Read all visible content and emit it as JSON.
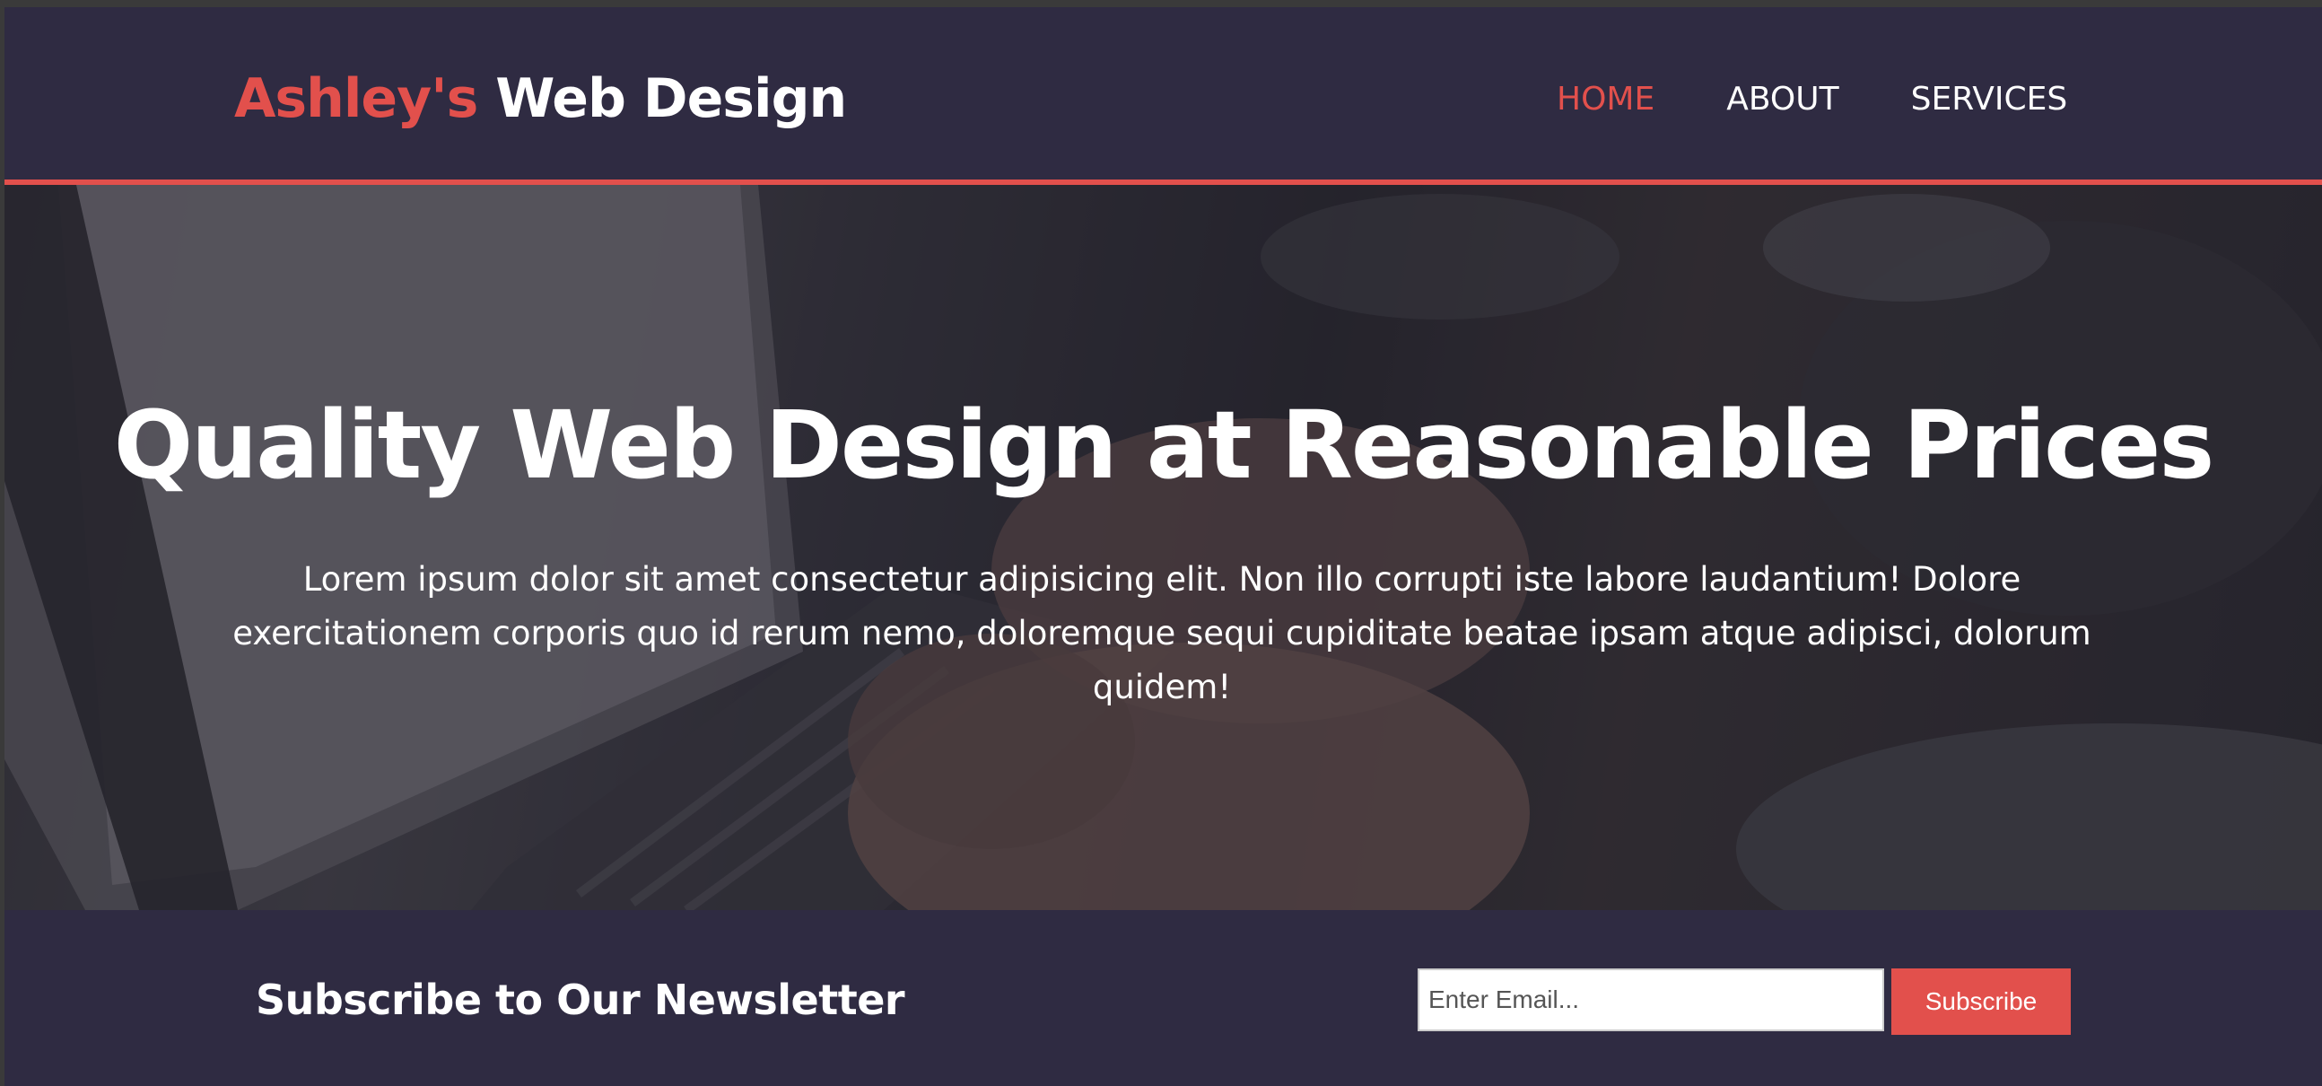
{
  "header": {
    "logo_accent": "Ashley's",
    "logo_rest": " Web Design",
    "nav": [
      {
        "label": "HOME",
        "active": true
      },
      {
        "label": "ABOUT",
        "active": false
      },
      {
        "label": "SERVICES",
        "active": false
      }
    ]
  },
  "hero": {
    "title": "Quality Web Design at Reasonable Prices",
    "text": "Lorem ipsum dolor sit amet consectetur adipisicing elit. Non illo corrupti iste labore laudantium! Dolore exercitationem corporis quo id rerum nemo, doloremque sequi cupiditate beatae ipsam atque adipisci, dolorum quidem!"
  },
  "newsletter": {
    "title": "Subscribe to Our Newsletter",
    "email_placeholder": "Enter Email...",
    "email_value": "",
    "button_label": "Subscribe"
  },
  "colors": {
    "accent": "#e2504c",
    "dark": "#2f2b42",
    "text": "#ffffff"
  }
}
